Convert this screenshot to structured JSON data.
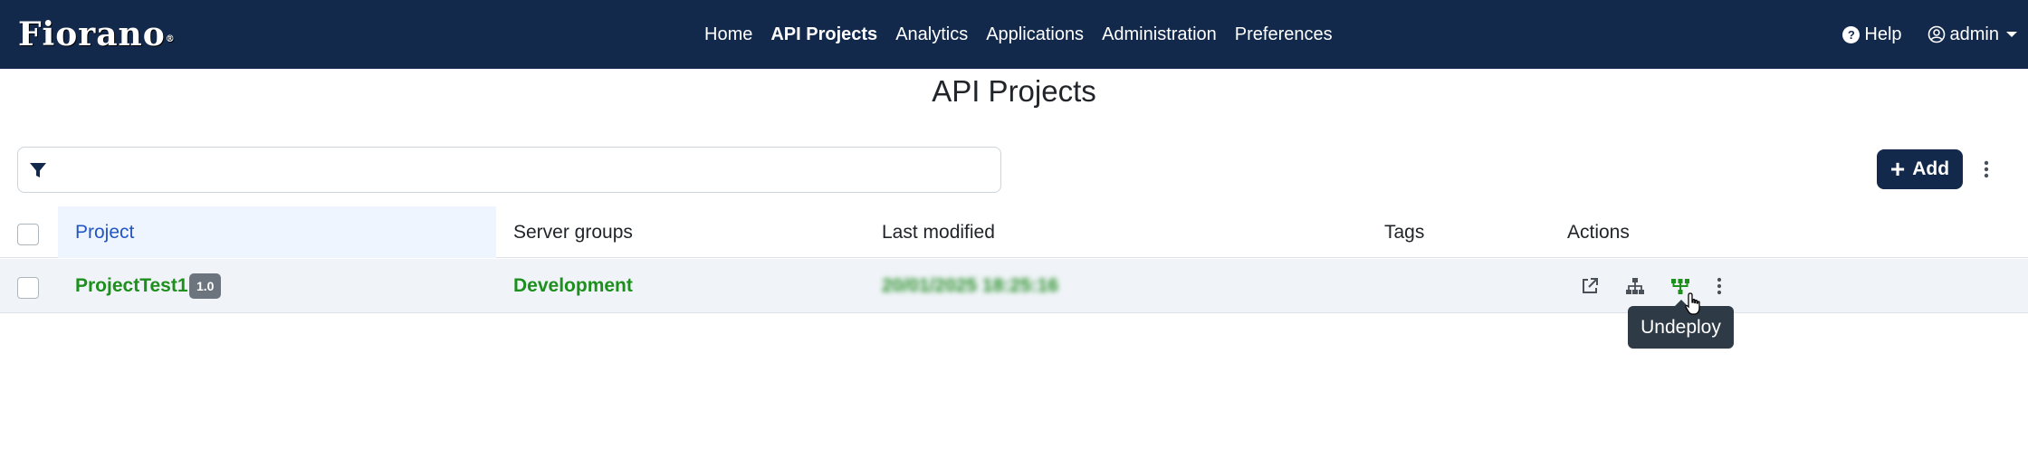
{
  "app": {
    "logo": "Fiorano",
    "logo_mark": "®"
  },
  "nav": {
    "items": [
      {
        "label": "Home",
        "active": false
      },
      {
        "label": "API Projects",
        "active": true
      },
      {
        "label": "Analytics",
        "active": false
      },
      {
        "label": "Applications",
        "active": false
      },
      {
        "label": "Administration",
        "active": false
      },
      {
        "label": "Preferences",
        "active": false
      }
    ],
    "help_icon_glyph": "?",
    "help_label": "Help",
    "user_label": "admin"
  },
  "page": {
    "title": "API Projects"
  },
  "toolbar": {
    "filter_value": "",
    "filter_placeholder": "",
    "add_label": "Add"
  },
  "table": {
    "columns": [
      "Project",
      "Server groups",
      "Last modified",
      "Tags",
      "Actions"
    ],
    "rows": [
      {
        "project": "ProjectTest1",
        "version": "1.0",
        "server_group": "Development",
        "last_modified": "20/01/2025 18:25:16",
        "tags": ""
      }
    ],
    "actions": [
      "open-external-icon",
      "hierarchy-icon",
      "undeploy-icon",
      "more-vertical-icon"
    ]
  },
  "tooltip": {
    "text": "Undeploy"
  },
  "colors": {
    "navbar": "#13294b",
    "link_green": "#1d8f1d",
    "header_blue": "#2255c5",
    "badge_gray": "#6c757d",
    "tooltip_bg": "#2f3a47"
  }
}
